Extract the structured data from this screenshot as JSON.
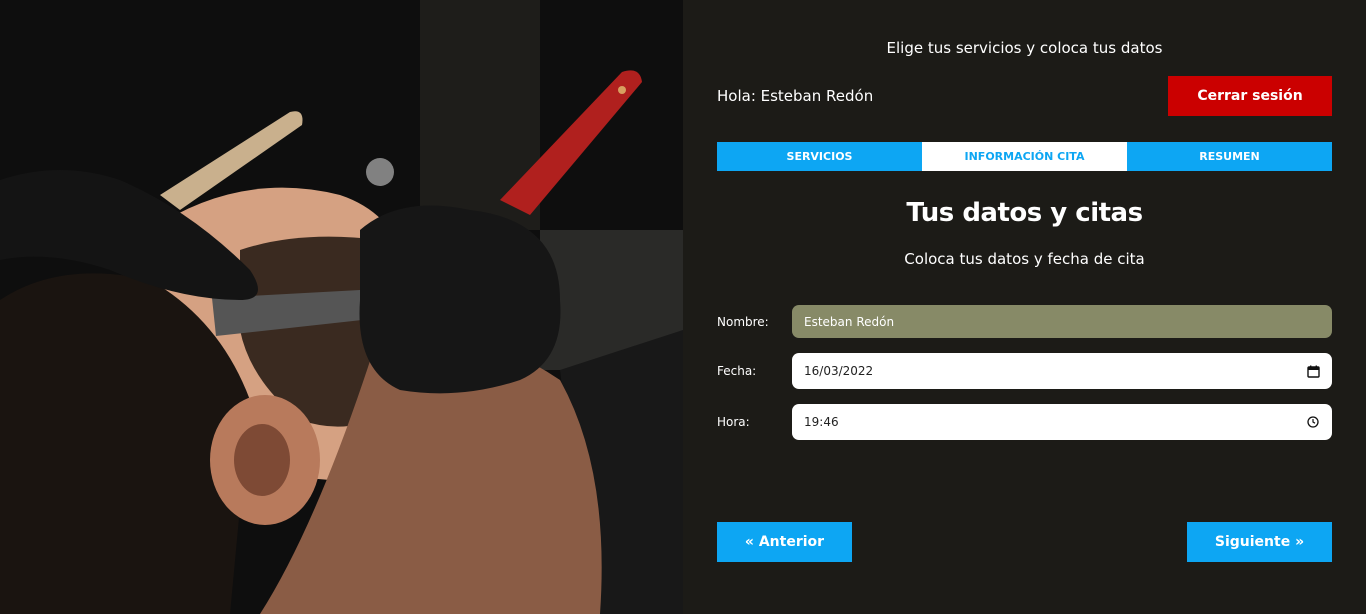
{
  "header": {
    "tagline": "Elige tus servicios y coloca tus datos",
    "greeting": "Hola: Esteban Redón",
    "logout_label": "Cerrar sesión"
  },
  "tabs": [
    {
      "label": "Servicios",
      "active": false
    },
    {
      "label": "Información Cita",
      "active": true
    },
    {
      "label": "Resumen",
      "active": false
    }
  ],
  "section": {
    "title": "Tus datos y citas",
    "subtitle": "Coloca tus datos y fecha de cita"
  },
  "form": {
    "name_label": "Nombre:",
    "name_value": "Esteban Redón",
    "date_label": "Fecha:",
    "date_value": "16/03/2022",
    "time_label": "Hora:",
    "time_value": "19:46"
  },
  "navigation": {
    "prev_label": "« Anterior",
    "next_label": "Siguiente »"
  },
  "colors": {
    "background": "#1c1b17",
    "accent": "#0da6f3",
    "logout": "#cb0000",
    "disabled_field": "#878a67"
  },
  "icons": [
    "calendar-icon",
    "clock-icon"
  ]
}
